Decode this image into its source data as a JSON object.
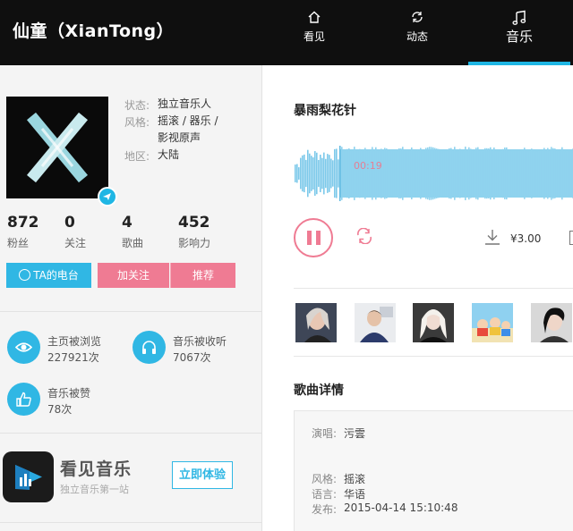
{
  "header": {
    "title": "仙童（XianTong）",
    "tabs": [
      {
        "label": "看见",
        "icon": "home-icon"
      },
      {
        "label": "动态",
        "icon": "refresh-icon"
      },
      {
        "label": "音乐",
        "icon": "music-note-icon",
        "active": true
      }
    ]
  },
  "profile": {
    "info": [
      {
        "label": "状态:",
        "value": "独立音乐人"
      },
      {
        "label": "风格:",
        "value": "摇滚 / 器乐 / 影视原声"
      },
      {
        "label": "地区:",
        "value": "大陆"
      }
    ],
    "stats": [
      {
        "value": "872",
        "label": "粉丝"
      },
      {
        "value": "0",
        "label": "关注"
      },
      {
        "value": "4",
        "label": "歌曲"
      },
      {
        "value": "452",
        "label": "影响力"
      }
    ],
    "buttons": {
      "radio": "TA的电台",
      "follow": "加关注",
      "recommend": "推荐"
    }
  },
  "activity": [
    {
      "label": "主页被浏览",
      "value": "227921次",
      "icon": "eye-icon"
    },
    {
      "label": "音乐被收听",
      "value": "7067次",
      "icon": "headphones-icon"
    },
    {
      "label": "音乐被赞",
      "value": "78次",
      "icon": "thumbs-up-icon"
    }
  ],
  "promo": {
    "name": "看见音乐",
    "tagline": "独立音乐第一站",
    "button": "立即体验"
  },
  "player": {
    "song_title": "暴雨梨花针",
    "current_time": "00:19",
    "price": "¥3.00",
    "progress": 0.16
  },
  "details": {
    "heading": "歌曲详情",
    "singer_label": "演唱:",
    "singer": "污雲",
    "style_label": "风格:",
    "style": "摇滚",
    "lang_label": "语言:",
    "lang": "华语",
    "date_label": "发布:",
    "date": "2015-04-14 15:10:48"
  },
  "colors": {
    "accent": "#30b7e4",
    "pink": "#ef7b93",
    "header_bg": "#0f0f0f"
  }
}
